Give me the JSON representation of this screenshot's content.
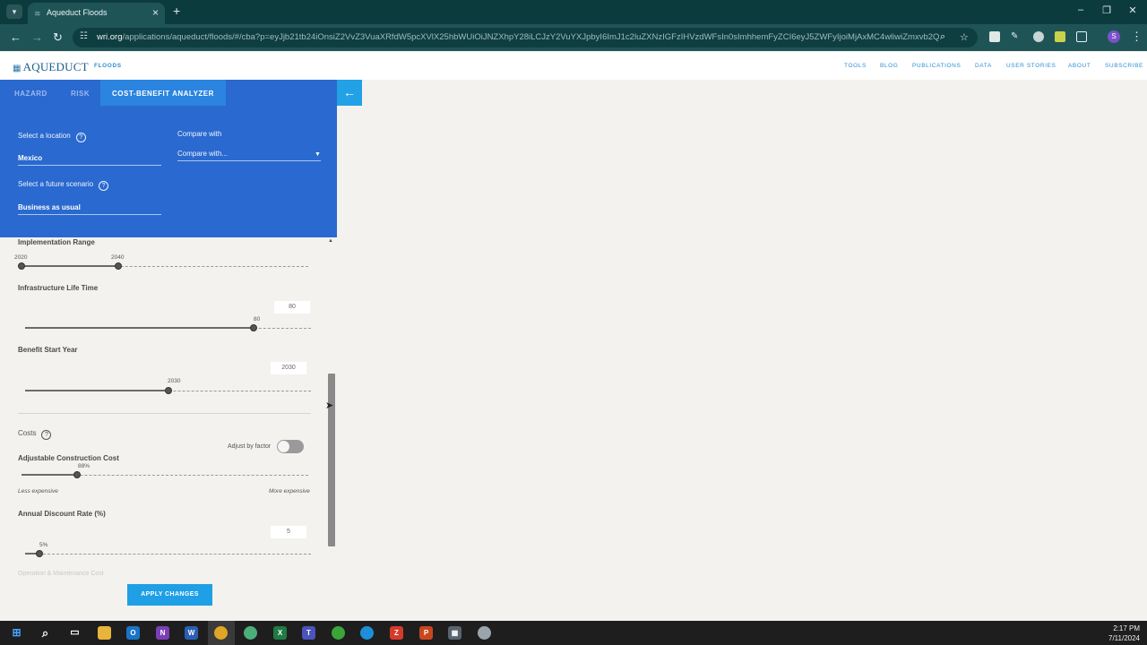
{
  "browser": {
    "tab_title": "Aqueduct Floods",
    "url_host": "wri.org",
    "url_rest": "/applications/aqueduct/floods/#/cba?p=eyJjb21tb24iOnsiZ2VvZ3VuaXRfdW5pcXVlX25hbWUiOiJNZXhpY28iLCJzY2VuYXJpbyI6ImJ1c2luZXNzIGFzIHVzdWFsIn0sImhhemFyZCI6eyJ5ZWFyIjoiMjAxMC4wliwiZmxvb2QiOiJpbn...",
    "avatar_letter": "S"
  },
  "site": {
    "logo": "AQUEDUCT",
    "logo_sub": "FLOODS",
    "nav": [
      "TOOLS",
      "BLOG",
      "PUBLICATIONS",
      "DATA",
      "USER STORIES",
      "ABOUT",
      "SUBSCRIBE"
    ]
  },
  "panel": {
    "tabs": [
      "HAZARD",
      "RISK",
      "COST-BENEFIT ANALYZER"
    ],
    "location_label": "Select a location",
    "location_value": "Mexico",
    "compare_label": "Compare with",
    "compare_value": "Compare with...",
    "scenario_label": "Select a future scenario",
    "scenario_value": "Business as usual",
    "implementation": {
      "label": "Implementation Range",
      "min": "2020",
      "max": "2040"
    },
    "life_time": {
      "label": "Infrastructure Life Time",
      "value": "80",
      "box": "80"
    },
    "benefit_start": {
      "label": "Benefit Start Year",
      "value": "2030",
      "box": "2030"
    },
    "costs_label": "Costs",
    "adjust_factor": "Adjust by factor",
    "construction": {
      "label": "Adjustable Construction Cost",
      "value": "88%",
      "less": "Less expensive",
      "more": "More expensive"
    },
    "discount": {
      "label": "Annual Discount Rate (%)",
      "value": "5%",
      "box": "5"
    },
    "faded_label": "Operation & Maintenance Cost",
    "apply": "APPLY CHANGES"
  },
  "taskbar": {
    "time": "2:17 PM",
    "date": "7/11/2024"
  }
}
